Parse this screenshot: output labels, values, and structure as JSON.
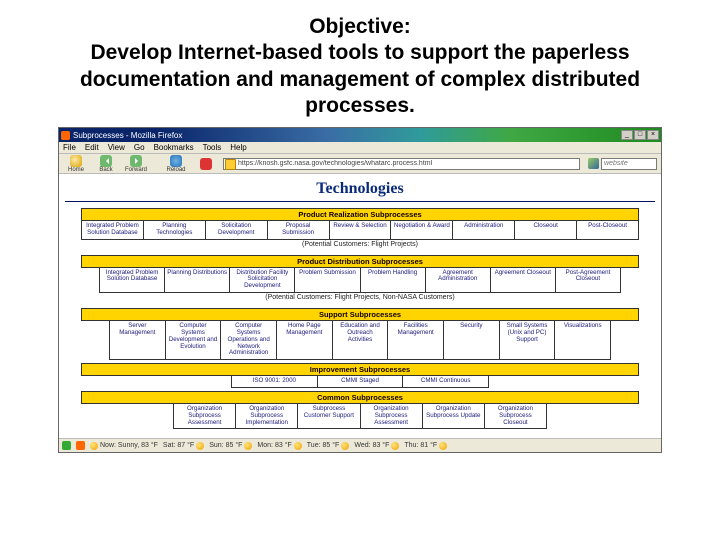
{
  "slide": {
    "title_line1": "Objective:",
    "title_line2": "Develop Internet-based tools to support the paperless documentation and management of complex distributed processes."
  },
  "window": {
    "title": "Subprocesses - Mozilla Firefox",
    "min": "_",
    "max": "□",
    "close": "×"
  },
  "menu": [
    "File",
    "Edit",
    "View",
    "Go",
    "Bookmarks",
    "Tools",
    "Help"
  ],
  "toolbar": {
    "home": "Home",
    "back": "Back",
    "forward": "Forward",
    "reload": "Reload",
    "address": "https://knosh.gsfc.nasa.gov/technologies/whatarc.process.html",
    "search_placeholder": "website"
  },
  "page_title": "Technologies",
  "sections": [
    {
      "header": "Product Realization Subprocesses",
      "cells": [
        "Integrated Problem Solution Database",
        "Planning Technologies",
        "Solicitation Development",
        "Proposal Submission",
        "Review & Selection",
        "Negotiation & Award",
        "Administration",
        "Closeout",
        "Post-Closeout"
      ],
      "note": "(Potential Customers: Flight Projects)"
    },
    {
      "header": "Product Distribution Subprocesses",
      "cells": [
        "Integrated Problem Solution Database",
        "Planning Distributions",
        "Distribution Facility Solicitation Development",
        "Problem Submission",
        "Problem Handling",
        "Agreement Administration",
        "Agreement Closeout",
        "Post-Agreement Closeout"
      ],
      "note": "(Potential Customers: Flight Projects, Non-NASA Customers)"
    },
    {
      "header": "Support Subprocesses",
      "cells": [
        "Server Management",
        "Computer Systems Development and Evolution",
        "Computer Systems Operations and Network Administration",
        "Home Page Management",
        "Education and Outreach Activities",
        "Facilities Management",
        "Security",
        "Small Systems (Unix and PC) Support",
        "Visualizations"
      ]
    },
    {
      "header": "Improvement Subprocesses",
      "cells": [
        "ISO 9001: 2000",
        "CMMI Staged",
        "CMMI Continuous"
      ]
    },
    {
      "header": "Common Subprocesses",
      "cells": [
        "Organization Subprocess Assessment",
        "Organization Subprocess Implementation",
        "Subprocess Customer Support",
        "Organization Subprocess Assessment",
        "Organization Subprocess Update",
        "Organization Subprocess Closeout"
      ]
    }
  ],
  "statusbar": {
    "now": "Now: Sunny, 83 °F",
    "days": [
      {
        "d": "Sat:",
        "t": "87 °F"
      },
      {
        "d": "Sun:",
        "t": "85 °F"
      },
      {
        "d": "Mon:",
        "t": "83 °F"
      },
      {
        "d": "Tue:",
        "t": "85 °F"
      },
      {
        "d": "Wed:",
        "t": "83 °F"
      },
      {
        "d": "Thu:",
        "t": "81 °F"
      }
    ]
  }
}
